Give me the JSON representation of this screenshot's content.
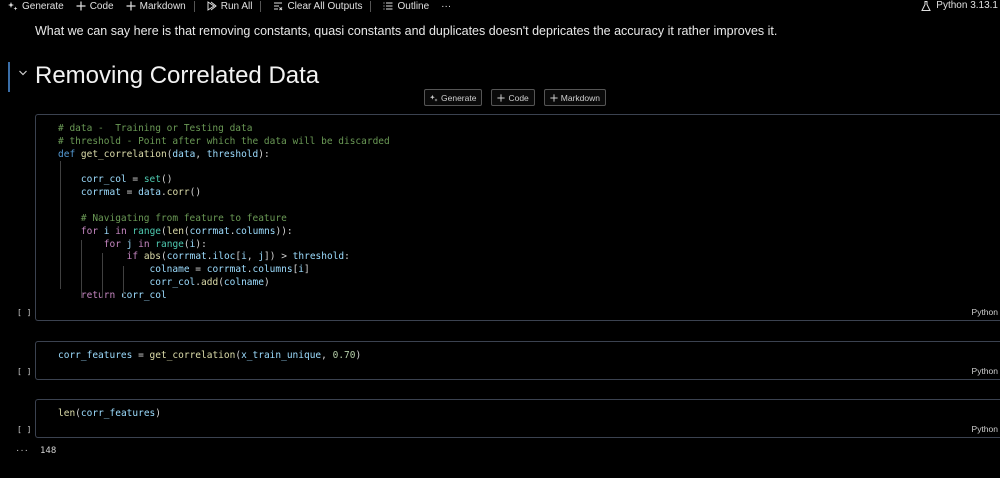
{
  "toolbar": {
    "generate": "Generate",
    "code": "Code",
    "markdown": "Markdown",
    "run_all": "Run All",
    "clear_outputs": "Clear All Outputs",
    "outline": "Outline",
    "more": "···",
    "kernel": "Python 3.13.1"
  },
  "markdown_cell": {
    "text": "What we can say here is that removing constants, quasi constants and duplicates doesn't depricates the accuracy it rather improves it."
  },
  "heading_cell": {
    "title": "Removing Correlated Data"
  },
  "insert_buttons": {
    "generate": "Generate",
    "code": "Code",
    "markdown": "Markdown"
  },
  "cells": [
    {
      "exec_label": "[ ]",
      "language": "Python",
      "lines": [
        [
          {
            "t": "# data -  Training or Testing data",
            "c": "comment"
          }
        ],
        [
          {
            "t": "# threshold - Point after which the data will be discarded",
            "c": "comment"
          }
        ],
        [
          {
            "t": "def ",
            "c": "kw"
          },
          {
            "t": "get_correlation",
            "c": "fn"
          },
          {
            "t": "(",
            "c": "p"
          },
          {
            "t": "data",
            "c": "var"
          },
          {
            "t": ", ",
            "c": "p"
          },
          {
            "t": "threshold",
            "c": "var"
          },
          {
            "t": "):",
            "c": "p"
          }
        ],
        [
          {
            "t": "",
            "c": "p"
          }
        ],
        [
          {
            "t": "    ",
            "c": "p"
          },
          {
            "t": "corr_col",
            "c": "var"
          },
          {
            "t": " = ",
            "c": "p"
          },
          {
            "t": "set",
            "c": "cls"
          },
          {
            "t": "()",
            "c": "p"
          }
        ],
        [
          {
            "t": "    ",
            "c": "p"
          },
          {
            "t": "corrmat",
            "c": "var"
          },
          {
            "t": " = ",
            "c": "p"
          },
          {
            "t": "data",
            "c": "var"
          },
          {
            "t": ".",
            "c": "p"
          },
          {
            "t": "corr",
            "c": "fn"
          },
          {
            "t": "()",
            "c": "p"
          }
        ],
        [
          {
            "t": "",
            "c": "p"
          }
        ],
        [
          {
            "t": "    ",
            "c": "p"
          },
          {
            "t": "# Navigating from feature to feature",
            "c": "comment"
          }
        ],
        [
          {
            "t": "    ",
            "c": "p"
          },
          {
            "t": "for ",
            "c": "ctl"
          },
          {
            "t": "i",
            "c": "var"
          },
          {
            "t": " in ",
            "c": "ctl"
          },
          {
            "t": "range",
            "c": "cls"
          },
          {
            "t": "(",
            "c": "p"
          },
          {
            "t": "len",
            "c": "fn"
          },
          {
            "t": "(",
            "c": "p"
          },
          {
            "t": "corrmat",
            "c": "var"
          },
          {
            "t": ".",
            "c": "p"
          },
          {
            "t": "columns",
            "c": "var"
          },
          {
            "t": ")):",
            "c": "p"
          }
        ],
        [
          {
            "t": "        ",
            "c": "p"
          },
          {
            "t": "for ",
            "c": "ctl"
          },
          {
            "t": "j",
            "c": "var"
          },
          {
            "t": " in ",
            "c": "ctl"
          },
          {
            "t": "range",
            "c": "cls"
          },
          {
            "t": "(",
            "c": "p"
          },
          {
            "t": "i",
            "c": "var"
          },
          {
            "t": "):",
            "c": "p"
          }
        ],
        [
          {
            "t": "            ",
            "c": "p"
          },
          {
            "t": "if ",
            "c": "ctl"
          },
          {
            "t": "abs",
            "c": "fn"
          },
          {
            "t": "(",
            "c": "p"
          },
          {
            "t": "corrmat",
            "c": "var"
          },
          {
            "t": ".",
            "c": "p"
          },
          {
            "t": "iloc",
            "c": "var"
          },
          {
            "t": "[",
            "c": "p"
          },
          {
            "t": "i",
            "c": "var"
          },
          {
            "t": ", ",
            "c": "p"
          },
          {
            "t": "j",
            "c": "var"
          },
          {
            "t": "]) > ",
            "c": "p"
          },
          {
            "t": "threshold",
            "c": "var"
          },
          {
            "t": ":",
            "c": "p"
          }
        ],
        [
          {
            "t": "                ",
            "c": "p"
          },
          {
            "t": "colname",
            "c": "var"
          },
          {
            "t": " = ",
            "c": "p"
          },
          {
            "t": "corrmat",
            "c": "var"
          },
          {
            "t": ".",
            "c": "p"
          },
          {
            "t": "columns",
            "c": "var"
          },
          {
            "t": "[",
            "c": "p"
          },
          {
            "t": "i",
            "c": "var"
          },
          {
            "t": "]",
            "c": "p"
          }
        ],
        [
          {
            "t": "                ",
            "c": "p"
          },
          {
            "t": "corr_col",
            "c": "var"
          },
          {
            "t": ".",
            "c": "p"
          },
          {
            "t": "add",
            "c": "fn"
          },
          {
            "t": "(",
            "c": "p"
          },
          {
            "t": "colname",
            "c": "var"
          },
          {
            "t": ")",
            "c": "p"
          }
        ],
        [
          {
            "t": "    ",
            "c": "p"
          },
          {
            "t": "return ",
            "c": "ctl"
          },
          {
            "t": "corr_col",
            "c": "var"
          }
        ]
      ]
    },
    {
      "exec_label": "[ ]",
      "language": "Python",
      "lines": [
        [
          {
            "t": "corr_features",
            "c": "var"
          },
          {
            "t": " = ",
            "c": "p"
          },
          {
            "t": "get_correlation",
            "c": "fn"
          },
          {
            "t": "(",
            "c": "p"
          },
          {
            "t": "x_train_unique",
            "c": "var"
          },
          {
            "t": ", ",
            "c": "p"
          },
          {
            "t": "0.70",
            "c": "num"
          },
          {
            "t": ")",
            "c": "p"
          }
        ]
      ]
    },
    {
      "exec_label": "[ ]",
      "language": "Python",
      "lines": [
        [
          {
            "t": "len",
            "c": "fn"
          },
          {
            "t": "(",
            "c": "p"
          },
          {
            "t": "corr_features",
            "c": "var"
          },
          {
            "t": ")",
            "c": "p"
          }
        ]
      ]
    }
  ],
  "output": {
    "more": "···",
    "value": "148"
  },
  "colors": {
    "comment": "#6a9955",
    "kw": "#569cd6",
    "fn": "#dcdcaa",
    "var": "#9cdcfe",
    "cls": "#4ec9b0",
    "ctl": "#c586c0",
    "num": "#b5cea8",
    "p": "#d4d4d4",
    "cell_border": "#3b4250"
  }
}
